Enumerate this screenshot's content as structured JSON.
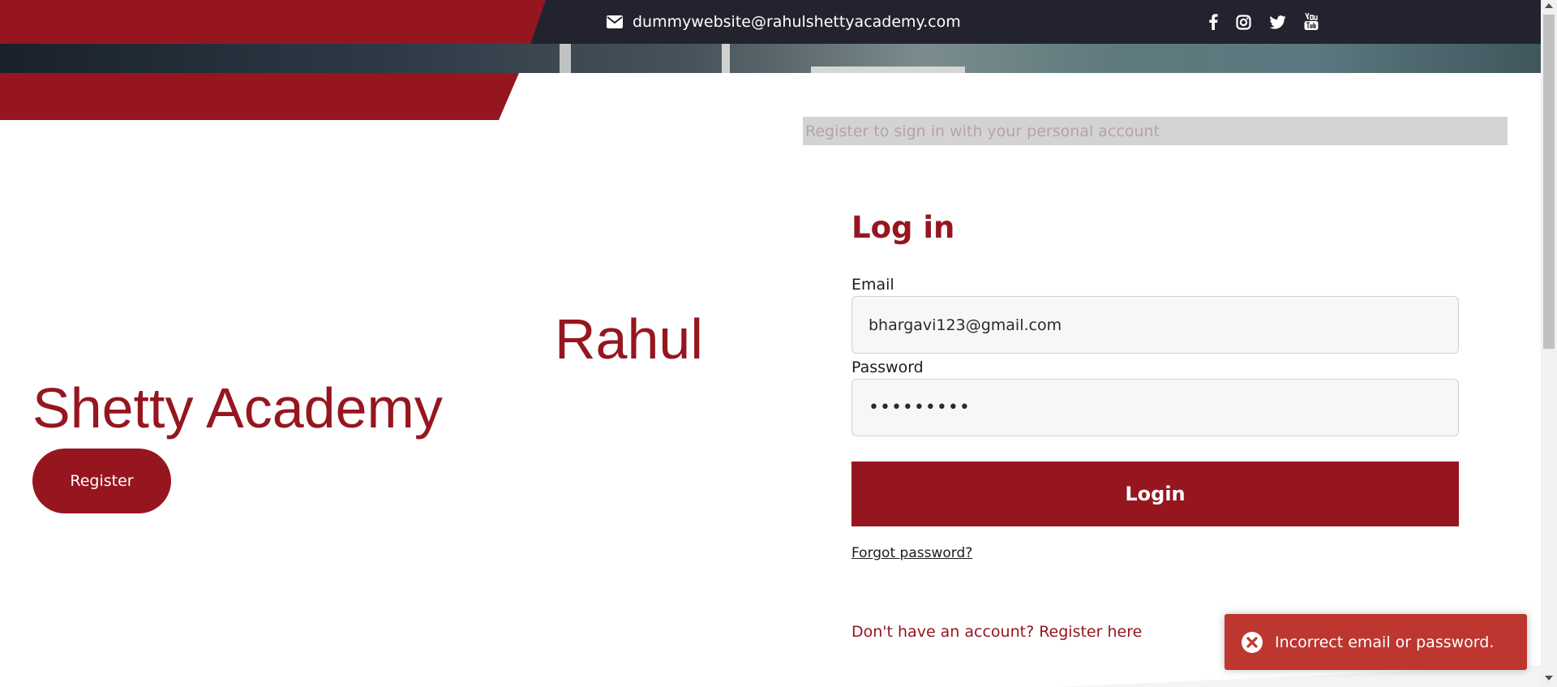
{
  "header": {
    "email_icon": "envelope-icon",
    "email": "dummywebsite@rahulshettyacademy.com",
    "social": [
      "facebook-icon",
      "instagram-icon",
      "twitter-icon",
      "youtube-icon"
    ]
  },
  "hero": {
    "line1": "Rahul",
    "line2": "Shetty Academy",
    "register_label": "Register"
  },
  "form": {
    "banner_text": "Register to sign in with your personal account",
    "title": "Log in",
    "email_label": "Email",
    "email_value": "bhargavi123@gmail.com",
    "password_label": "Password",
    "password_value": "•••••••••",
    "login_label": "Login",
    "forgot_label": "Forgot password?",
    "register_link": "Don't have an account? Register here"
  },
  "toast": {
    "icon": "error-circle-icon",
    "message": "Incorrect email or password."
  },
  "colors": {
    "brand_red": "#961620",
    "topbar_dark": "#23222f",
    "toast_red": "#bd362f"
  }
}
